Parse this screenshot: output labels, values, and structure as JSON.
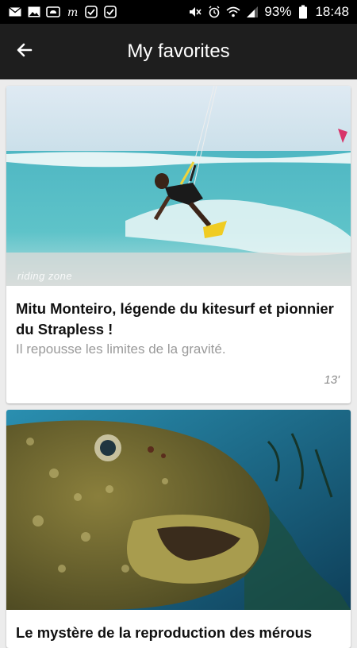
{
  "status_bar": {
    "left_icons": [
      "mail-icon",
      "image-icon",
      "cloud-icon",
      "news-icon",
      "check-box-icon",
      "check-box-icon"
    ],
    "battery_percent": "93%",
    "time": "18:48",
    "right_icons": [
      "mute-icon",
      "alarm-icon",
      "wifi-icon",
      "signal-icon",
      "battery-icon"
    ]
  },
  "app_bar": {
    "title": "My favorites",
    "back_icon": "arrow-left-icon"
  },
  "favorites": [
    {
      "title": "Mitu Monteiro, légende du kitesurf et pionnier du Strapless !",
      "subtitle": "Il repousse les limites de la gravité.",
      "duration": "13'",
      "image_watermark": "riding zone"
    },
    {
      "title": "Le mystère de la reproduction des mérous"
    }
  ]
}
